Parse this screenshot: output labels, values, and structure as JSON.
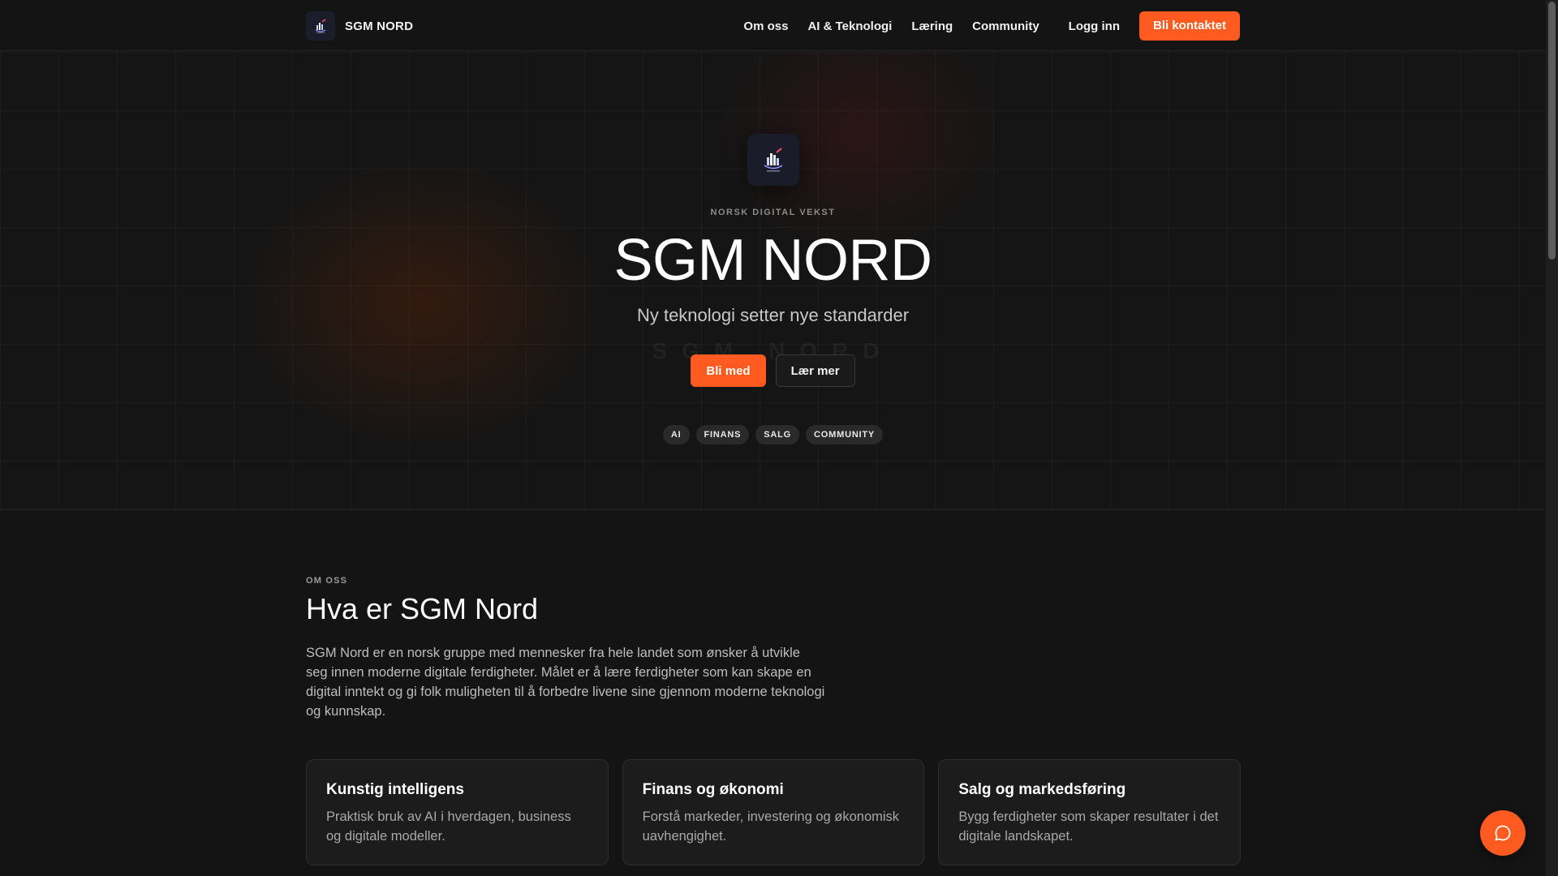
{
  "nav": {
    "brand": "SGM NORD",
    "links": [
      "Om oss",
      "AI & Teknologi",
      "Læring",
      "Community"
    ],
    "login": "Logg inn",
    "contact": "Bli kontaktet"
  },
  "hero": {
    "eyebrow": "NORSK DIGITAL VEKST",
    "title": "SGM NORD",
    "subtitle": "Ny teknologi setter nye standarder",
    "ghost": "SGM NORD",
    "primary_button": "Bli med",
    "secondary_button": "Lær mer",
    "tags": [
      "AI",
      "FINANS",
      "SALG",
      "COMMUNITY"
    ]
  },
  "about": {
    "eyebrow": "OM OSS",
    "title": "Hva er SGM Nord",
    "text": "SGM Nord er en norsk gruppe med mennesker fra hele landet som ønsker å utvikle seg innen moderne digitale ferdigheter. Målet er å lære ferdigheter som kan skape en digital inntekt og gi folk muligheten til å forbedre livene sine gjennom moderne teknologi og kunnskap.",
    "cards": [
      {
        "title": "Kunstig intelligens",
        "text": "Praktisk bruk av AI i hverdagen, business og digitale modeller."
      },
      {
        "title": "Finans og økonomi",
        "text": "Forstå markeder, investering og økonomisk uavhengighet."
      },
      {
        "title": "Salg og markedsføring",
        "text": "Bygg ferdigheter som skaper resultater i det digitale landskapet."
      }
    ]
  },
  "colors": {
    "accent": "#ff5a1f",
    "background": "#141414"
  },
  "icons": {
    "brand": "sgm-logo-icon",
    "chat": "chat-bubble-icon"
  }
}
